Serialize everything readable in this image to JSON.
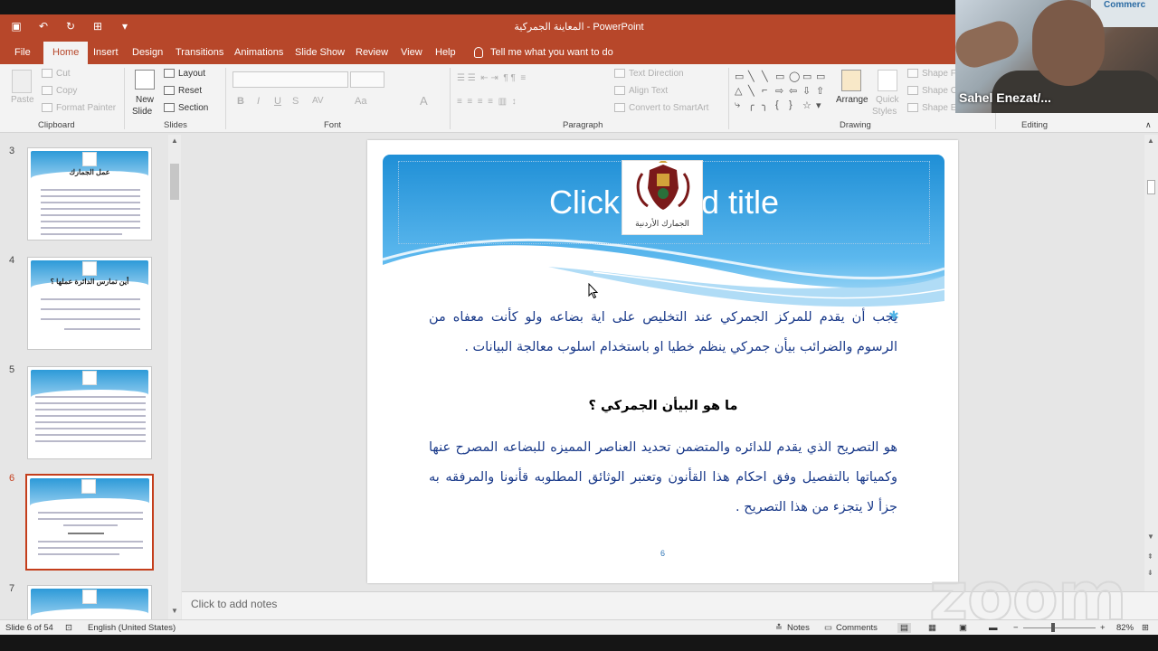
{
  "window": {
    "title": "المعاينة الجمركية  -  PowerPoint"
  },
  "qat": {
    "save": "save-icon",
    "undo": "undo-icon",
    "redo": "redo-icon",
    "customize": "customize-icon"
  },
  "tabs": [
    "File",
    "Home",
    "Insert",
    "Design",
    "Transitions",
    "Animations",
    "Slide Show",
    "Review",
    "View",
    "Help"
  ],
  "tell_me": "Tell me what you want to do",
  "ribbon": {
    "clipboard": {
      "paste": "Paste",
      "cut": "Cut",
      "copy": "Copy",
      "format_painter": "Format Painter",
      "label": "Clipboard"
    },
    "slides": {
      "new_slide_1": "New",
      "new_slide_2": "Slide",
      "layout": "Layout",
      "reset": "Reset",
      "section": "Section",
      "label": "Slides"
    },
    "font": {
      "label": "Font",
      "bold": "B",
      "italic": "I",
      "underline": "U",
      "strike": "S",
      "spacing": "AV",
      "case": "Aa",
      "color": "A"
    },
    "paragraph": {
      "text_direction": "Text Direction",
      "align_text": "Align Text",
      "convert": "Convert to SmartArt",
      "label": "Paragraph"
    },
    "drawing": {
      "arrange": "Arrange",
      "quick_styles_1": "Quick",
      "quick_styles_2": "Styles",
      "shape_fill": "Shape Fill",
      "shape_outline": "Shape Outline",
      "shape_effects": "Shape Effects",
      "label": "Drawing"
    },
    "editing": {
      "label": "Editing"
    }
  },
  "webcam": {
    "name": "Sahel Enezat/...",
    "sign_text": "Commerc"
  },
  "thumbnails": [
    {
      "num": "3",
      "title": "عمل الجمارك"
    },
    {
      "num": "4",
      "title": "أين تمارس الدائرة عملها ؟"
    },
    {
      "num": "5",
      "title": ""
    },
    {
      "num": "6",
      "title": ""
    },
    {
      "num": "7",
      "title": ""
    }
  ],
  "slide": {
    "title_placeholder": "Click to add title",
    "emblem_caption": "الجمارك الأردنية",
    "bullet_text": "يجب أن يقدم للمركز الجمركي عند التخليص على اية بضاعه ولو كأنت معفاه من الرسوم والضرائب بيأن جمركي ينظم خطيا او باستخدام اسلوب معالجة البيانات .",
    "question": "ما هو البيأن الجمركي ؟",
    "definition": "هو التصريح الذي يقدم للدائره والمتضمن تحديد العناصر المميزه للبضاعه المصرح عنها وكمياتها بالتفصيل وفق احكام هذا القأنون وتعتبر الوثائق المطلوبه قأنونا والمرفقه به جزأ لا يتجزء من هذا التصريح .",
    "number": "6"
  },
  "notes_placeholder": "Click to add notes",
  "status": {
    "slide_info": "Slide 6 of 54",
    "language": "English (United States)",
    "notes": "Notes",
    "comments": "Comments",
    "zoom": "82%"
  },
  "zoom_watermark": "zoom",
  "colors": {
    "accent": "#b7472a",
    "slide_text": "#1a3a8a",
    "band_blue": "#2d9ad8"
  }
}
